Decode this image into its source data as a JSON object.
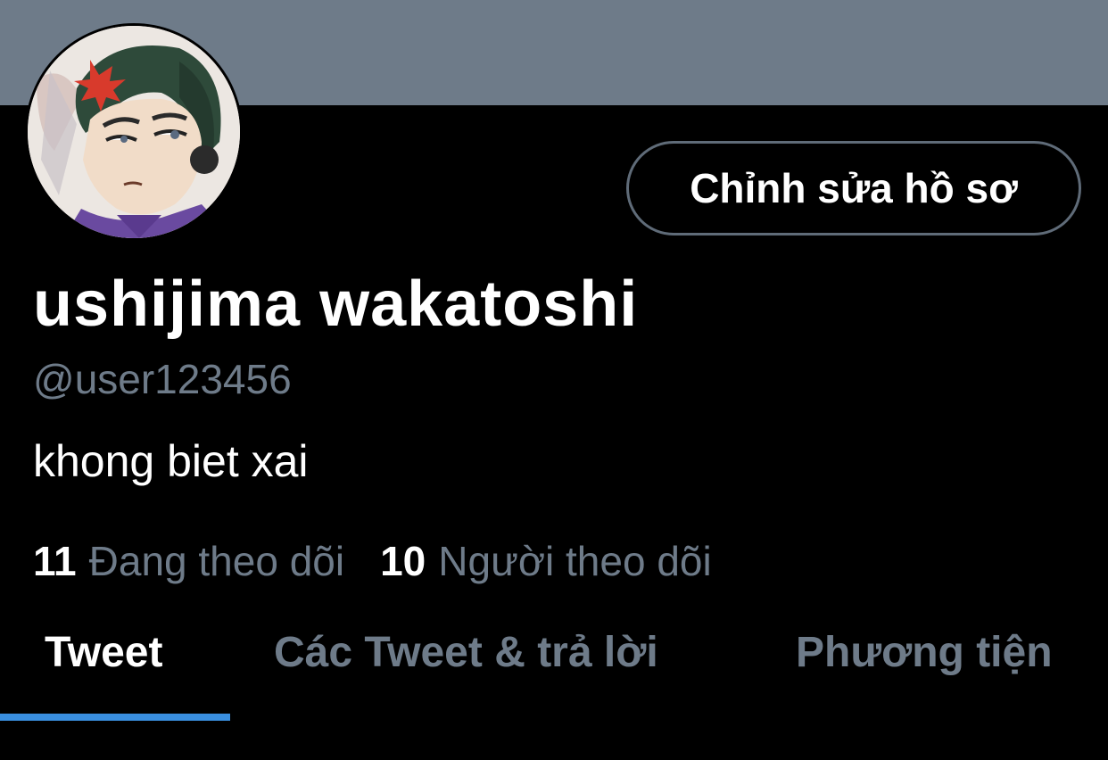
{
  "profile": {
    "edit_button_label": "Chỉnh sửa hồ sơ",
    "display_name": "ushijima wakatoshi",
    "handle": "@user123456",
    "bio": "khong biet xai",
    "following_count": "11",
    "following_label": "Đang theo dõi",
    "followers_count": "10",
    "followers_label": "Người theo dõi"
  },
  "tabs": [
    {
      "label": "Tweet",
      "active": true
    },
    {
      "label": "Các Tweet & trả lời",
      "active": false
    },
    {
      "label": "Phương tiện",
      "active": false
    }
  ],
  "colors": {
    "banner": "#6e7b89",
    "background": "#000000",
    "secondary_text": "#6e7b89",
    "accent": "#3a8fe0"
  },
  "icons": {
    "avatar": "anime-character-avatar"
  }
}
